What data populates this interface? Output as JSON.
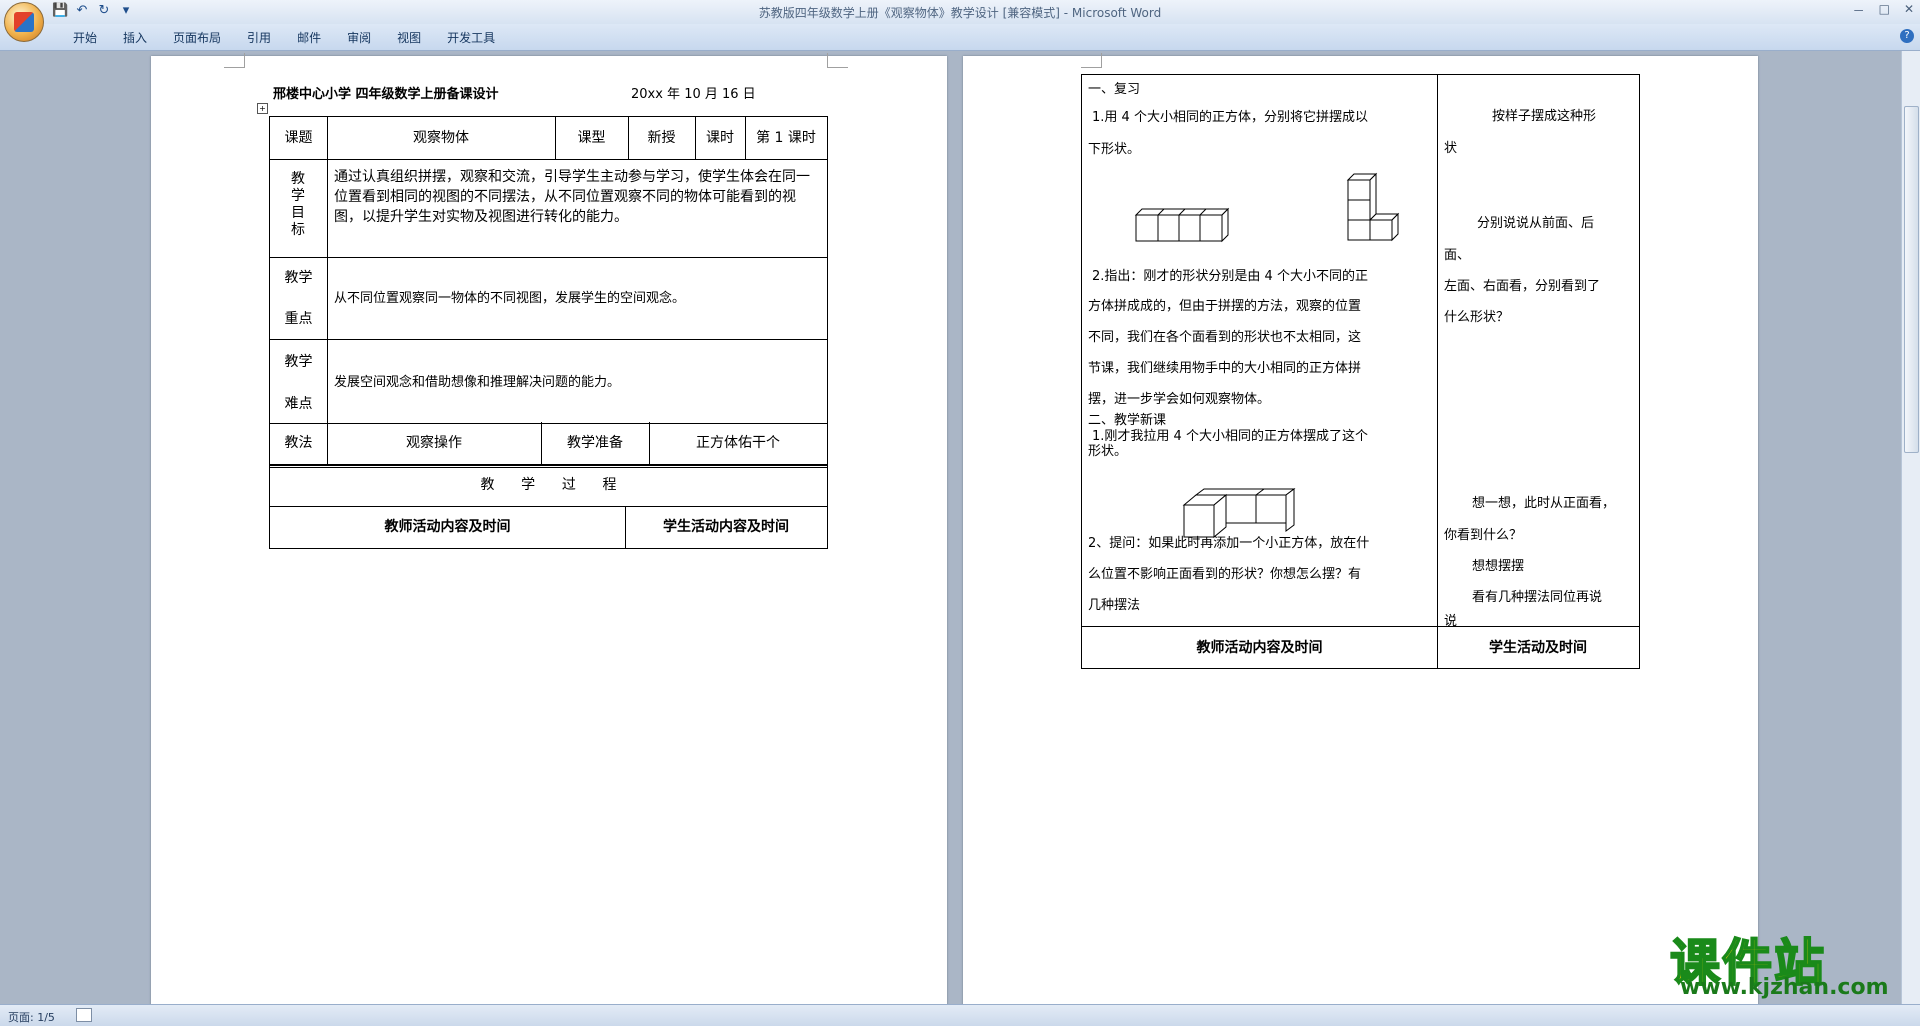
{
  "window": {
    "title": "苏教版四年级数学上册《观察物体》教学设计 [兼容模式] - Microsoft Word",
    "min": "－",
    "max": "□",
    "close": "✕"
  },
  "ribbon": {
    "tabs": [
      "开始",
      "插入",
      "页面布局",
      "引用",
      "邮件",
      "审阅",
      "视图",
      "开发工具"
    ],
    "help": "?"
  },
  "qat": {
    "save": "💾",
    "undo": "↶",
    "redo": "↻",
    "more": "▾"
  },
  "status": {
    "page": "页面: 1/5"
  },
  "page1": {
    "header_school": "邢楼中心小学  四年级数学上册备课设计",
    "header_date": "20xx 年 10  月 16  日",
    "row1": {
      "k1": "课题",
      "v1": "观察物体",
      "k2": "课型",
      "v2": "新授",
      "k3": "课时",
      "v3": "第 1 课时"
    },
    "objective_label": "教学目标",
    "objective_text": "通过认真组织拼摆，观察和交流，引导学生主动参与学习，使学生体会在同一位置看到相同的视图的不同摆法，从不同位置观察不同的物体可能看到的视图，以提升学生对实物及视图进行转化的能力。",
    "key_label_a": "教学",
    "key_label_b": "重点",
    "key_text": "从不同位置观察同一物体的不同视图，发展学生的空间观念。",
    "diff_label_a": "教学",
    "diff_label_b": "难点",
    "diff_text": "发展空间观念和借助想像和推理解决问题的能力。",
    "method_label": "教法",
    "method_value": "观察操作",
    "prep_label": "教学准备",
    "prep_value": "正方体佑干个",
    "process": "教      学      过      程",
    "teacher_head": "教师活动内容及时间",
    "student_head": "学生活动内容及时间"
  },
  "page2": {
    "review": "一、复习",
    "r1a": "1.用 4 个大小相同的正方体，分别将它拼摆成以",
    "r1b": "下形状。",
    "r2a": "2.指出：刚才的形状分别是由 4 个大小不同的正",
    "r2b": "方体拼成成的，但由于拼摆的方法，观察的位置",
    "r2c": "不同，我们在各个面看到的形状也不太相同，这",
    "r2d": "节课，我们继续用物手中的大小相同的正方体拼",
    "r2e": "摆，进一步学会如何观察物体。",
    "newlesson": "二、教学新课",
    "n1a": "1.刚才我拉用 4 个大小相同的正方体摆成了这个",
    "n1b": "形状。",
    "q2a": "2、提问：如果此时再添加一个小正方体，放在什",
    "q2b": "么位置不影响正面看到的形状？你想怎么摆？有",
    "q2c": "几种摆法",
    "s1a": "按样子摆成这种形",
    "s1b": "状",
    "s2a": "分别说说从前面、后",
    "s2b": "面、",
    "s2c": "左面、右面看，分别看到了",
    "s2d": "什么形状？",
    "s3a": "想一想，此时从正面看，",
    "s3b": "你看到什么？",
    "s4": "想想摆摆",
    "s5a": "看有几种摆法同位再说",
    "s5b": "说",
    "teacher_head": "教师活动内容及时间",
    "student_head": "学生活动及时间"
  },
  "watermark": {
    "brand": "课件站",
    "url": "www.kjzhan.com"
  }
}
